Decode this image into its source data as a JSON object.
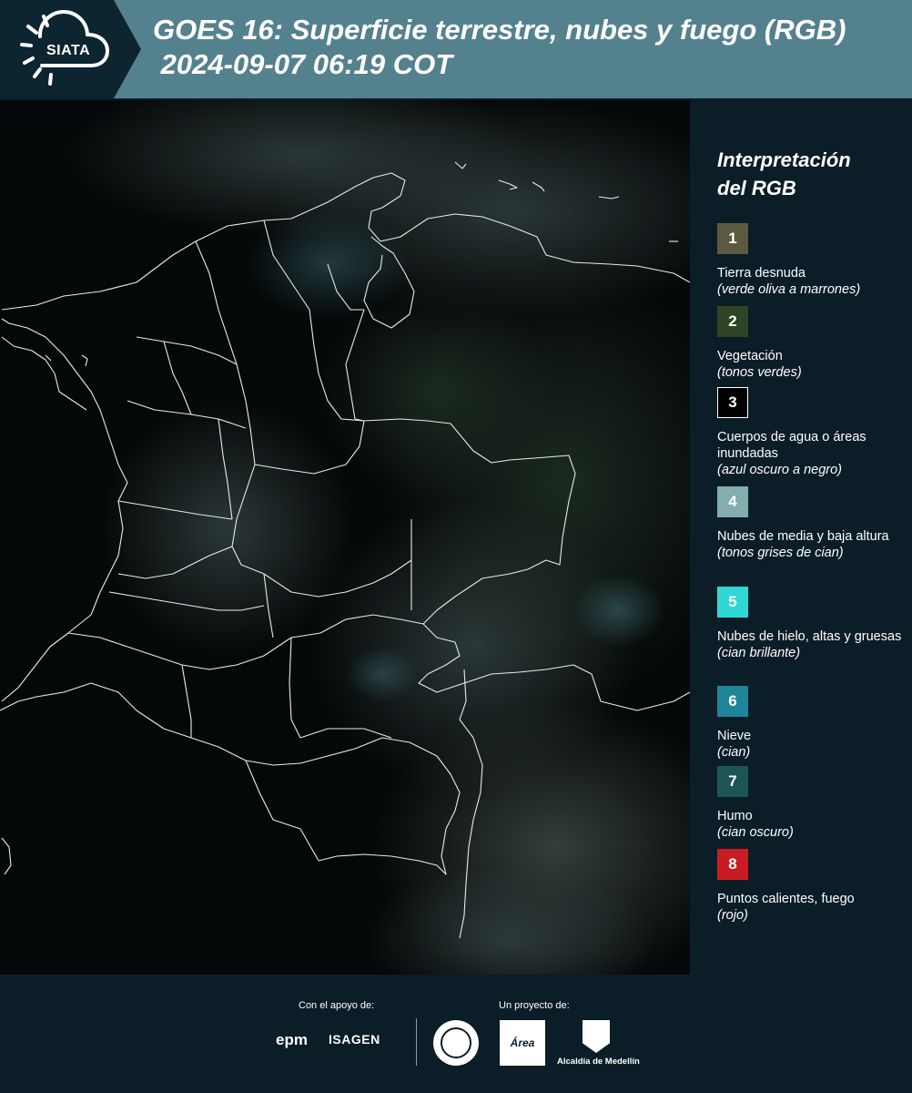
{
  "header": {
    "logo_text": "SIATA",
    "title_line1": "GOES 16: Superficie terrestre, nubes y fuego (RGB)",
    "title_line2": " 2024-09-07 06:19 COT"
  },
  "legend": {
    "title": "Interpretación\ndel RGB",
    "items": [
      {
        "num": "1",
        "name": "Tierra desnuda",
        "desc": "(verde oliva a marrones)",
        "color": "#595a3f",
        "outlined": false
      },
      {
        "num": "2",
        "name": "Vegetación",
        "desc": "(tonos verdes)",
        "color": "#2e4424",
        "outlined": false
      },
      {
        "num": "3",
        "name": "Cuerpos de agua o áreas inundadas",
        "desc": "(azul oscuro a negro)",
        "color": "#000000",
        "outlined": true
      },
      {
        "num": "4",
        "name": "Nubes de media y baja altura",
        "desc": "(tonos grises de cian)",
        "color": "#84adad",
        "outlined": false
      },
      {
        "num": "5",
        "name": "Nubes de hielo, altas y gruesas",
        "desc": "(cian brillante)",
        "color": "#2fd8d4",
        "outlined": false
      },
      {
        "num": "6",
        "name": "Nieve",
        "desc": "(cian)",
        "color": "#20859a",
        "outlined": false
      },
      {
        "num": "7",
        "name": "Humo",
        "desc": "(cian oscuro)",
        "color": "#1d5556",
        "outlined": false
      },
      {
        "num": "8",
        "name": "Puntos calientes, fuego",
        "desc": "(rojo)",
        "color": "#c81c22",
        "outlined": false
      }
    ]
  },
  "footer": {
    "support_label": "Con el apoyo de:",
    "project_label": "Un proyecto de:",
    "epm": "epm",
    "isagen": "ISAGEN",
    "area_logo_text": "Área",
    "alcaldia": "Alcaldía de Medellín"
  },
  "colors": {
    "header_bg": "#54818e",
    "logo_bg": "#0d2431",
    "page_bg": "#0b1d27",
    "map_bg": "#050809",
    "border_lines": "#e6ecec"
  }
}
